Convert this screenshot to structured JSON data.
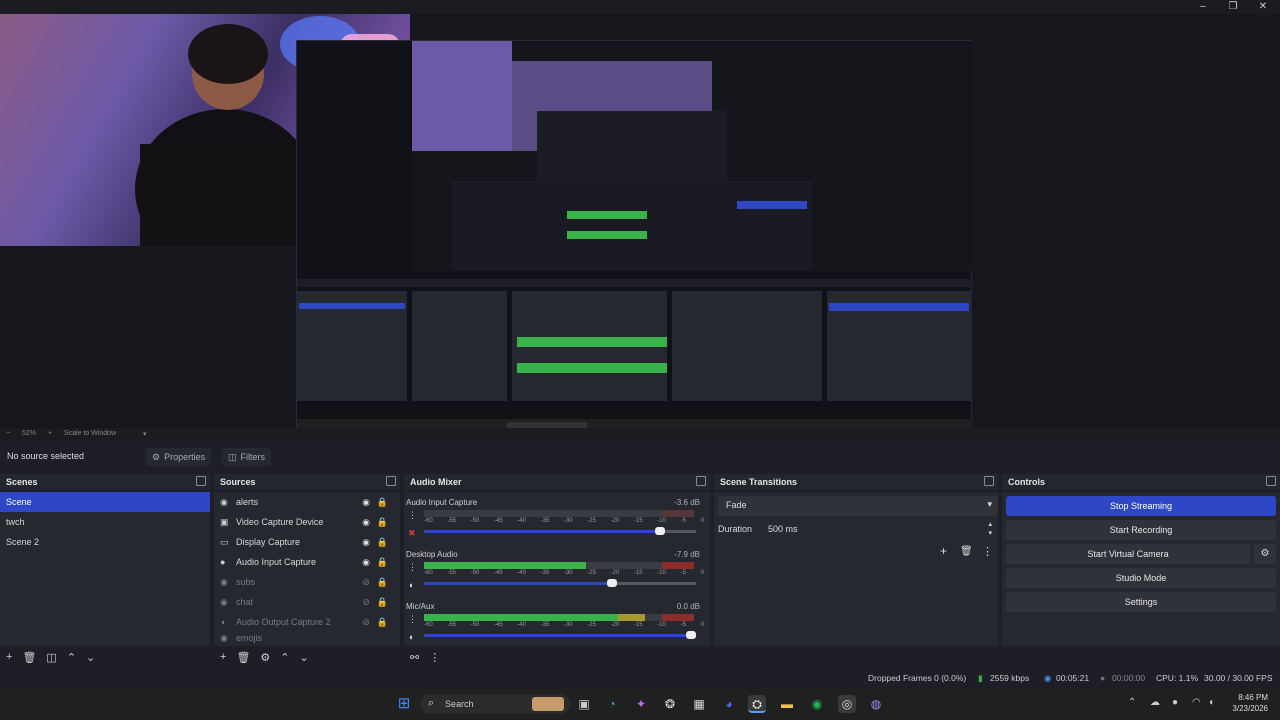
{
  "window": {
    "minimize": "–",
    "maximize": "❐",
    "close": "✕"
  },
  "preview": {
    "zoom": "52%",
    "scale_mode": "Scale to Window"
  },
  "context_bar": {
    "no_source": "No source selected",
    "properties": "Properties",
    "filters": "Filters"
  },
  "scenes": {
    "title": "Scenes",
    "items": [
      {
        "label": "Scene",
        "selected": true
      },
      {
        "label": "twch",
        "selected": false
      },
      {
        "label": "Scene 2",
        "selected": false
      }
    ]
  },
  "sources": {
    "title": "Sources",
    "items": [
      {
        "label": "alerts",
        "icon": "globe-icon",
        "visible": true
      },
      {
        "label": "Video Capture Device",
        "icon": "camera-icon",
        "visible": true
      },
      {
        "label": "Display Capture",
        "icon": "monitor-icon",
        "visible": true
      },
      {
        "label": "Audio Input Capture",
        "icon": "mic-icon",
        "visible": true
      },
      {
        "label": "subs",
        "icon": "globe-icon",
        "visible": false
      },
      {
        "label": "chat",
        "icon": "globe-icon",
        "visible": false
      },
      {
        "label": "Audio Output Capture 2",
        "icon": "speaker-icon",
        "visible": false
      },
      {
        "label": "emojis",
        "icon": "globe-icon",
        "visible": false
      }
    ]
  },
  "audio_mixer": {
    "title": "Audio Mixer",
    "ticks": [
      "-60",
      "-55",
      "-50",
      "-45",
      "-40",
      "-35",
      "-30",
      "-25",
      "-20",
      "-15",
      "-10",
      "-5",
      "0"
    ],
    "channels": [
      {
        "name": "Audio Input Capture",
        "db": "-3.6 dB",
        "level": 0.0,
        "volume": 0.88,
        "muted": true
      },
      {
        "name": "Desktop Audio",
        "db": "-7.9 dB",
        "level": 0.6,
        "volume": 0.7,
        "muted": false
      },
      {
        "name": "Mic/Aux",
        "db": "0.0 dB",
        "level": 0.82,
        "volume": 1.0,
        "muted": false
      }
    ]
  },
  "scene_transitions": {
    "title": "Scene Transitions",
    "transition": "Fade",
    "duration_label": "Duration",
    "duration_value": "500 ms"
  },
  "controls": {
    "title": "Controls",
    "buttons": [
      "Stop Streaming",
      "Start Recording",
      "Start Virtual Camera",
      "Studio Mode",
      "Settings"
    ]
  },
  "status": {
    "dropped_frames": "Dropped Frames 0 (0.0%)",
    "bitrate": "2559 kbps",
    "stream_time": "00:05:21",
    "rec_time": "00:00:00",
    "cpu": "CPU: 1.1%",
    "fps": "30.00 / 30.00 FPS"
  },
  "taskbar": {
    "search": "Search",
    "time": "8:46 PM",
    "date": "3/23/2026"
  },
  "colors": {
    "accent": "#2e47c4",
    "meter_green": "#38b249",
    "meter_yellow": "#a59a2a",
    "meter_red": "#8e2b2b"
  }
}
